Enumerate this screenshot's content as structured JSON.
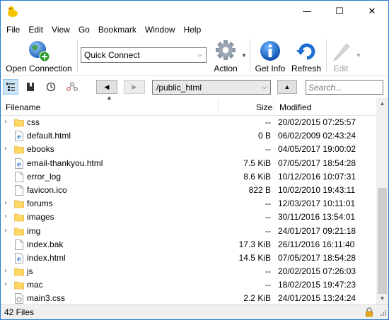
{
  "window": {
    "min_glyph": "—",
    "max_glyph": "☐",
    "close_glyph": "✕"
  },
  "menu": [
    "File",
    "Edit",
    "View",
    "Go",
    "Bookmark",
    "Window",
    "Help"
  ],
  "toolbar": {
    "open_connection": "Open Connection",
    "quick_connect": "Quick Connect",
    "action": "Action",
    "get_info": "Get Info",
    "refresh": "Refresh",
    "edit": "Edit"
  },
  "nav": {
    "path": "/public_html",
    "search_placeholder": "Search..."
  },
  "columns": {
    "filename": "Filename",
    "size": "Size",
    "modified": "Modified"
  },
  "files": [
    {
      "name": "css",
      "size": "--",
      "modified": "20/02/2015 07:25:57",
      "type": "folder"
    },
    {
      "name": "default.html",
      "size": "0 B",
      "modified": "06/02/2009 02:43:24",
      "type": "html"
    },
    {
      "name": "ebooks",
      "size": "--",
      "modified": "04/05/2017 19:00:02",
      "type": "folder"
    },
    {
      "name": "email-thankyou.html",
      "size": "7.5 KiB",
      "modified": "07/05/2017 18:54:28",
      "type": "html"
    },
    {
      "name": "error_log",
      "size": "8.6 KiB",
      "modified": "10/12/2016 10:07:31",
      "type": "file"
    },
    {
      "name": "favicon.ico",
      "size": "822 B",
      "modified": "10/02/2010 19:43:11",
      "type": "file"
    },
    {
      "name": "forums",
      "size": "--",
      "modified": "12/03/2017 10:11:01",
      "type": "folder"
    },
    {
      "name": "images",
      "size": "--",
      "modified": "30/11/2016 13:54:01",
      "type": "folder"
    },
    {
      "name": "img",
      "size": "--",
      "modified": "24/01/2017 09:21:18",
      "type": "folder"
    },
    {
      "name": "index.bak",
      "size": "17.3 KiB",
      "modified": "26/11/2016 16:11:40",
      "type": "file"
    },
    {
      "name": "index.html",
      "size": "14.5 KiB",
      "modified": "07/05/2017 18:54:28",
      "type": "html"
    },
    {
      "name": "js",
      "size": "--",
      "modified": "20/02/2015 07:26:03",
      "type": "folder"
    },
    {
      "name": "mac",
      "size": "--",
      "modified": "18/02/2015 19:47:23",
      "type": "folder"
    },
    {
      "name": "main3.css",
      "size": "2.2 KiB",
      "modified": "24/01/2015 13:24:24",
      "type": "css"
    }
  ],
  "status": {
    "count": "42 Files"
  },
  "colors": {
    "folder": "#ffd864",
    "folder_dark": "#e8b84a",
    "accent_blue": "#1e6fd0",
    "window_border": "#2b79d0"
  }
}
